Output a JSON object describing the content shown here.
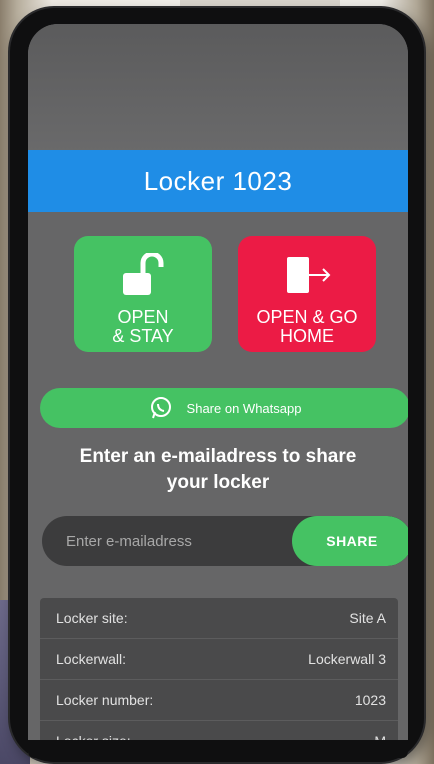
{
  "header": {
    "title": "Locker 1023"
  },
  "actions": {
    "open_stay": {
      "label": "OPEN\n& STAY"
    },
    "open_go_home": {
      "label": "OPEN & GO\nHOME"
    }
  },
  "whatsapp": {
    "label": "Share on Whatsapp"
  },
  "share": {
    "heading": "Enter an e-mailadress to share\nyour locker",
    "email_placeholder": "Enter e-mailadress",
    "button_label": "SHARE"
  },
  "details": {
    "rows": [
      {
        "label": "Locker site:",
        "value": "Site A"
      },
      {
        "label": "Lockerwall:",
        "value": "Lockerwall 3"
      },
      {
        "label": "Locker number:",
        "value": "1023"
      },
      {
        "label": "Locker size:",
        "value": "M"
      }
    ]
  },
  "colors": {
    "header": "#1f8de6",
    "green": "#45c263",
    "red": "#ec1b45",
    "screen_bg": "#666667"
  },
  "icons": {
    "open_stay": "unlock-icon",
    "open_go_home": "exit-door-icon",
    "whatsapp": "whatsapp-icon"
  }
}
